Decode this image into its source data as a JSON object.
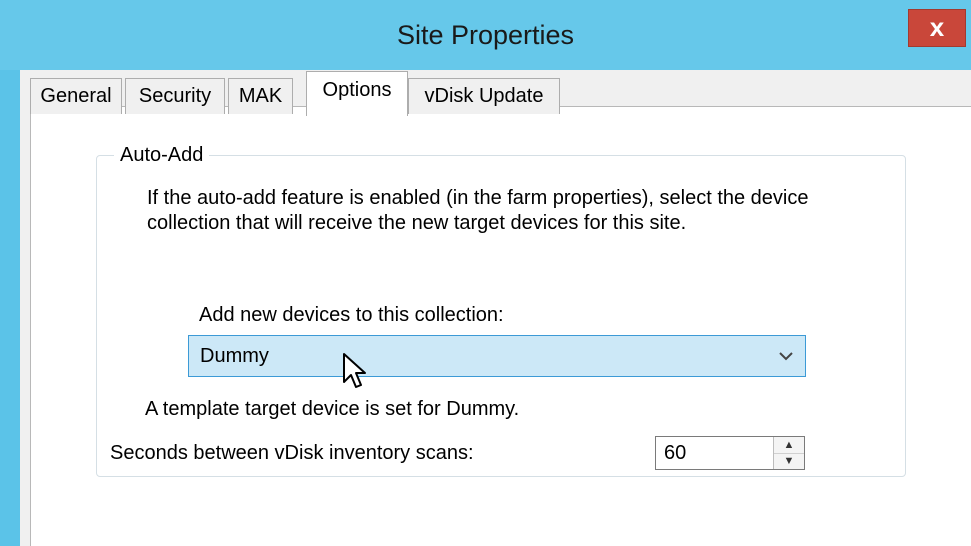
{
  "window": {
    "title": "Site Properties",
    "close_label": "x"
  },
  "tabs": [
    {
      "label": "General",
      "active": false
    },
    {
      "label": "Security",
      "active": false
    },
    {
      "label": "MAK",
      "active": false
    },
    {
      "label": "Options",
      "active": true
    },
    {
      "label": "vDisk Update",
      "active": false
    }
  ],
  "auto_add": {
    "group_title": "Auto-Add",
    "description_line1": "If the auto-add feature is enabled (in the farm properties), select the device",
    "description_line2": "collection that will receive the new target devices for this site.",
    "collection_label": "Add new devices to this collection:",
    "collection_value": "Dummy",
    "template_note": "A template target device is set for Dummy."
  },
  "inventory": {
    "label": "Seconds between vDisk inventory scans:",
    "value": "60"
  },
  "icons": {
    "close": "close-icon",
    "dropdown": "chevron-down-icon",
    "cursor": "mouse-pointer-icon",
    "spin_up": "spin-up-icon",
    "spin_down": "spin-down-icon"
  },
  "colors": {
    "titlebar": "#66c8ea",
    "close_button": "#c9473a",
    "combo_selected_bg": "#cce8f7",
    "combo_border": "#3c9ad6"
  }
}
